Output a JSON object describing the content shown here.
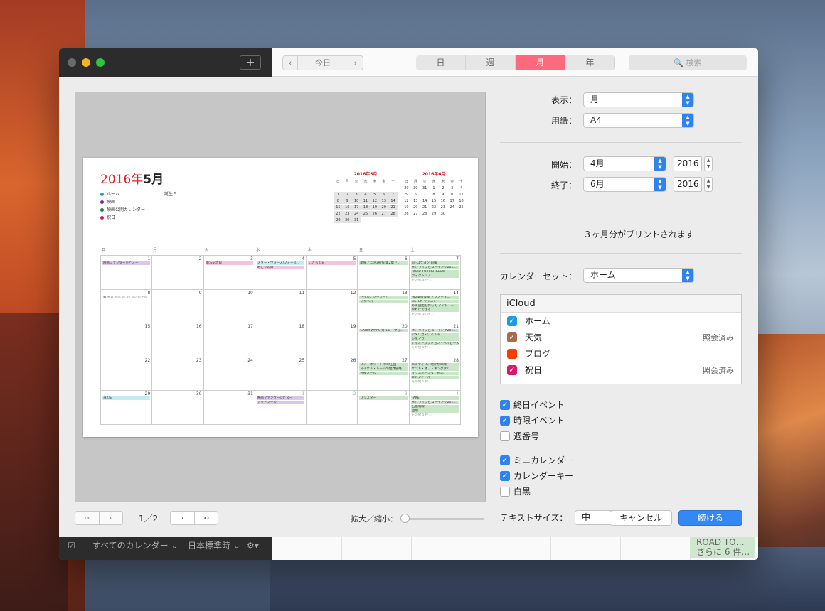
{
  "toolbar": {
    "plus": "+",
    "prev": "‹",
    "today": "今日",
    "next": "›",
    "views": [
      "日",
      "週",
      "月",
      "年"
    ],
    "active_view": "月",
    "search_placeholder": "🔍 検索"
  },
  "preview": {
    "title_year": "2016年",
    "title_month": "5月",
    "legend": [
      {
        "label": "ホーム",
        "color": "#1ba1e2"
      },
      {
        "label": "映画",
        "color": "#7a1fa2"
      },
      {
        "label": "映画公開カレンダー",
        "color": "#1f7a3a"
      },
      {
        "label": "祝日",
        "color": "#d4145a"
      }
    ],
    "legend_extra": {
      "label": "誕生日",
      "color": "#777777"
    },
    "mini_may": {
      "title": "2016年5月",
      "headers": [
        "日",
        "月",
        "火",
        "水",
        "木",
        "金",
        "土"
      ],
      "days": [
        "",
        "",
        "",
        "",
        "",
        "",
        "",
        "1",
        "2",
        "3",
        "4",
        "5",
        "6",
        "7",
        "8",
        "9",
        "10",
        "11",
        "12",
        "13",
        "14",
        "15",
        "16",
        "17",
        "18",
        "19",
        "20",
        "21",
        "22",
        "23",
        "24",
        "25",
        "26",
        "27",
        "28",
        "29",
        "30",
        "31",
        "",
        "",
        "",
        ""
      ]
    },
    "mini_jun": {
      "title": "2016年6月",
      "headers": [
        "日",
        "月",
        "火",
        "水",
        "木",
        "金",
        "土"
      ],
      "days": [
        "29",
        "30",
        "31",
        "1",
        "2",
        "3",
        "4",
        "5",
        "6",
        "7",
        "8",
        "9",
        "10",
        "11",
        "12",
        "13",
        "14",
        "15",
        "16",
        "17",
        "18",
        "19",
        "20",
        "21",
        "22",
        "23",
        "24",
        "25",
        "26",
        "27",
        "28",
        "29",
        "30",
        "",
        ""
      ]
    },
    "weekdays": [
      "日",
      "月",
      "火",
      "水",
      "木",
      "金",
      "土"
    ],
    "weeks": [
      [
        {
          "d": "1",
          "ev": [
            {
              "t": "映画ファンタージビズー",
              "c": "v"
            }
          ]
        },
        {
          "d": "2",
          "ev": []
        },
        {
          "d": "3",
          "ev": [
            {
              "t": "憲法記念日",
              "c": "p"
            }
          ]
        },
        {
          "d": "4",
          "ev": [
            {
              "t": "スター・ウォーズ/フォース…",
              "c": "c"
            },
            {
              "t": "みどりの日",
              "c": "p"
            }
          ]
        },
        {
          "d": "5",
          "ev": [
            {
              "t": "こどもの日",
              "c": "p"
            }
          ]
        },
        {
          "d": "6",
          "ev": [
            {
              "t": "劇場アニメ3部作 第2章「…",
              "c": "g"
            }
          ]
        },
        {
          "d": "7",
          "ev": [
            {
              "t": "64-ロクヨン-前編",
              "c": "g"
            },
            {
              "t": "METライブビューイング201…",
              "c": "g"
            },
            {
              "t": "ROAD TO HiGH&LOW",
              "c": "g"
            },
            {
              "t": "ヴィクトリア",
              "c": "g"
            },
            {
              "t": "その他 3 件…",
              "c": "w"
            }
          ]
        }
      ],
      [
        {
          "d": "8",
          "ev": [
            {
              "t": "■ 来賀 和彦 の 50 歳の誕生日",
              "c": "w"
            }
          ]
        },
        {
          "d": "9",
          "ev": []
        },
        {
          "d": "10",
          "ev": []
        },
        {
          "d": "11",
          "ev": []
        },
        {
          "d": "12",
          "ev": []
        },
        {
          "d": "13",
          "ev": [
            {
              "t": "ヘイル、シーザー！",
              "c": "g"
            },
            {
              "t": "マクベス",
              "c": "g"
            }
          ]
        },
        {
          "d": "14",
          "ev": [
            {
              "t": "HK/変態仮面 アブノーマ…",
              "c": "g"
            },
            {
              "t": "LISTEN リッスン",
              "c": "g"
            },
            {
              "t": "あぁ自由を探して アフター…",
              "c": "g"
            },
            {
              "t": "やればできる",
              "c": "g"
            },
            {
              "t": "その他 10 件…",
              "c": "w"
            }
          ]
        }
      ],
      [
        {
          "d": "15",
          "ev": []
        },
        {
          "d": "16",
          "ev": []
        },
        {
          "d": "17",
          "ev": []
        },
        {
          "d": "18",
          "ev": []
        },
        {
          "d": "19",
          "ev": []
        },
        {
          "d": "20",
          "ev": [
            {
              "t": "GARM WARS ガルム・ウォ…",
              "c": "g"
            }
          ]
        },
        {
          "d": "21",
          "ev": [
            {
              "t": "METライブビューイング201…",
              "c": "g"
            },
            {
              "t": "アメリカ・ワイルド",
              "c": "g"
            },
            {
              "t": "シネマラ",
              "c": "g"
            },
            {
              "t": "ディストラクション・ベイビーズ",
              "c": "g"
            },
            {
              "t": "その他 5 件…",
              "c": "w"
            }
          ]
        }
      ],
      [
        {
          "d": "22",
          "ev": []
        },
        {
          "d": "23",
          "ev": []
        },
        {
          "d": "24",
          "ev": []
        },
        {
          "d": "25",
          "ev": []
        },
        {
          "d": "26",
          "ev": []
        },
        {
          "d": "27",
          "ev": [
            {
              "t": "スノーホワイト/氷の王国",
              "c": "g"
            },
            {
              "t": "マイケル・ムーアの世界侵略…",
              "c": "g"
            },
            {
              "t": "神様メール",
              "c": "g"
            }
          ]
        },
        {
          "d": "28",
          "ev": [
            {
              "t": "ニュディス、地がかの敵",
              "c": "g"
            },
            {
              "t": "エンド・オブ・キングダム",
              "c": "g"
            },
            {
              "t": "サウスポー少女と初恋",
              "c": "g"
            },
            {
              "t": "ヒメアノ〜ル",
              "c": "g"
            },
            {
              "t": "その他 5 件…",
              "c": "w"
            }
          ]
        }
      ],
      [
        {
          "d": "29",
          "ev": [
            {
              "t": "海の日",
              "c": "c"
            }
          ]
        },
        {
          "d": "30",
          "ev": []
        },
        {
          "d": "31",
          "ev": []
        },
        {
          "d": "1",
          "o": true,
          "ev": [
            {
              "t": "映画ファンタージビズー",
              "c": "v"
            },
            {
              "t": "デッドプール",
              "c": "v"
            }
          ]
        },
        {
          "d": "2",
          "o": true,
          "ev": []
        },
        {
          "d": "3",
          "o": true,
          "ev": [
            {
              "t": "リリスター",
              "c": "g"
            }
          ]
        },
        {
          "d": "4",
          "o": true,
          "ev": [
            {
              "t": "FAKE",
              "c": "g"
            },
            {
              "t": "METライブビューイング201…",
              "c": "g"
            },
            {
              "t": "石鹸戦線",
              "c": "g"
            },
            {
              "t": "団地",
              "c": "g"
            },
            {
              "t": "その他 5 件…",
              "c": "w"
            }
          ]
        }
      ]
    ]
  },
  "pager": {
    "first": "‹‹",
    "prev": "‹",
    "page": "1／2",
    "next": "›",
    "last": "››",
    "zoom_label": "拡大／縮小：",
    "zoom_level": 0.0
  },
  "settings": {
    "view_label": "表示：",
    "view_value": "月",
    "paper_label": "用紙：",
    "paper_value": "A4",
    "start_label": "開始：",
    "start_month": "4月",
    "start_year": "2016",
    "end_label": "終了：",
    "end_month": "6月",
    "end_year": "2016",
    "info": "３ヶ月分がプリントされます",
    "calset_label": "カレンダーセット：",
    "calset_value": "ホーム",
    "icloud_header": "iCloud",
    "calendars": [
      {
        "name": "ホーム",
        "color": "#1b9ae8",
        "checked": true,
        "note": ""
      },
      {
        "name": "天気",
        "color": "#a86b4a",
        "checked": true,
        "note": "照会済み"
      },
      {
        "name": "ブログ",
        "color": "#ff3b00",
        "checked": false,
        "note": ""
      },
      {
        "name": "祝日",
        "color": "#e0156c",
        "checked": true,
        "note": "照会済み"
      }
    ],
    "opt_allday": "終日イベント",
    "opt_timed": "時限イベント",
    "opt_weeknum": "週番号",
    "opt_mini": "ミニカレンダー",
    "opt_key": "カレンダーキー",
    "opt_bw": "白黒",
    "textsize_label": "テキストサイズ：",
    "textsize_value": "中",
    "cancel": "キャンセル",
    "continue": "続ける",
    "checkmark": "✓"
  },
  "bottom": {
    "checkbox": "☑",
    "all_calendars": "すべてのカレンダー ⌄",
    "timezone": "日本標準時 ⌄",
    "gear": "⚙▾",
    "chip_line1": "ROAD TO…",
    "chip_line2": "さらに 6 件…"
  }
}
